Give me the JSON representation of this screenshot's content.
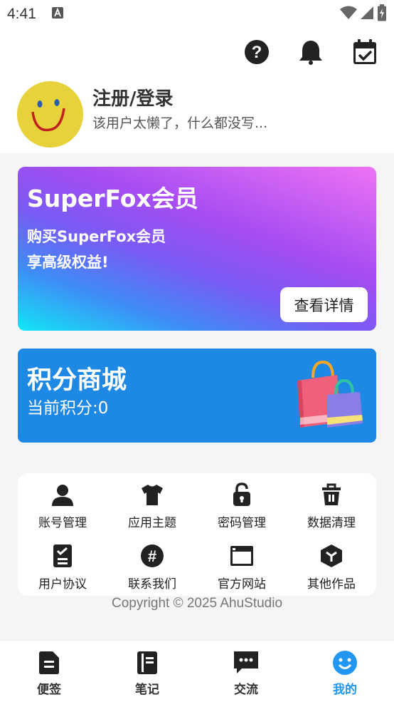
{
  "status_bar": {
    "time": "4:41",
    "icons": [
      "a-notification-icon",
      "wifi-icon",
      "signal-icon",
      "battery-charging-icon"
    ]
  },
  "header": {
    "icons": [
      "help-icon",
      "bell-icon",
      "calendar-check-icon"
    ],
    "user_name": "注册/登录",
    "user_bio": "该用户太懒了，什么都没写...",
    "avatar_icon": "smiley-avatar-icon",
    "avatar_color": "#e8d23c"
  },
  "vip_card": {
    "title": "SuperFox会员",
    "desc_line1": "购买SuperFox会员",
    "desc_line2": "享高级权益!",
    "button": "查看详情"
  },
  "points_card": {
    "title": "积分商城",
    "value_text": "当前积分:0",
    "icon": "shopping-bags-icon",
    "color": "#1e88e5"
  },
  "grid": {
    "items": [
      {
        "label": "账号管理",
        "icon": "user-icon"
      },
      {
        "label": "应用主题",
        "icon": "shirt-icon"
      },
      {
        "label": "密码管理",
        "icon": "lock-icon"
      },
      {
        "label": "数据清理",
        "icon": "trash-icon"
      },
      {
        "label": "用户协议",
        "icon": "checklist-icon"
      },
      {
        "label": "联系我们",
        "icon": "hash-icon"
      },
      {
        "label": "官方网站",
        "icon": "browser-icon"
      },
      {
        "label": "其他作品",
        "icon": "box-icon"
      }
    ]
  },
  "copyright": "Copyright © 2025 AhuStudio",
  "bottom_nav": {
    "active_color": "#2196f3",
    "items": [
      {
        "label": "便签",
        "icon": "note-icon"
      },
      {
        "label": "笔记",
        "icon": "notebook-icon"
      },
      {
        "label": "交流",
        "icon": "chat-icon"
      },
      {
        "label": "我的",
        "icon": "smile-icon"
      }
    ]
  }
}
